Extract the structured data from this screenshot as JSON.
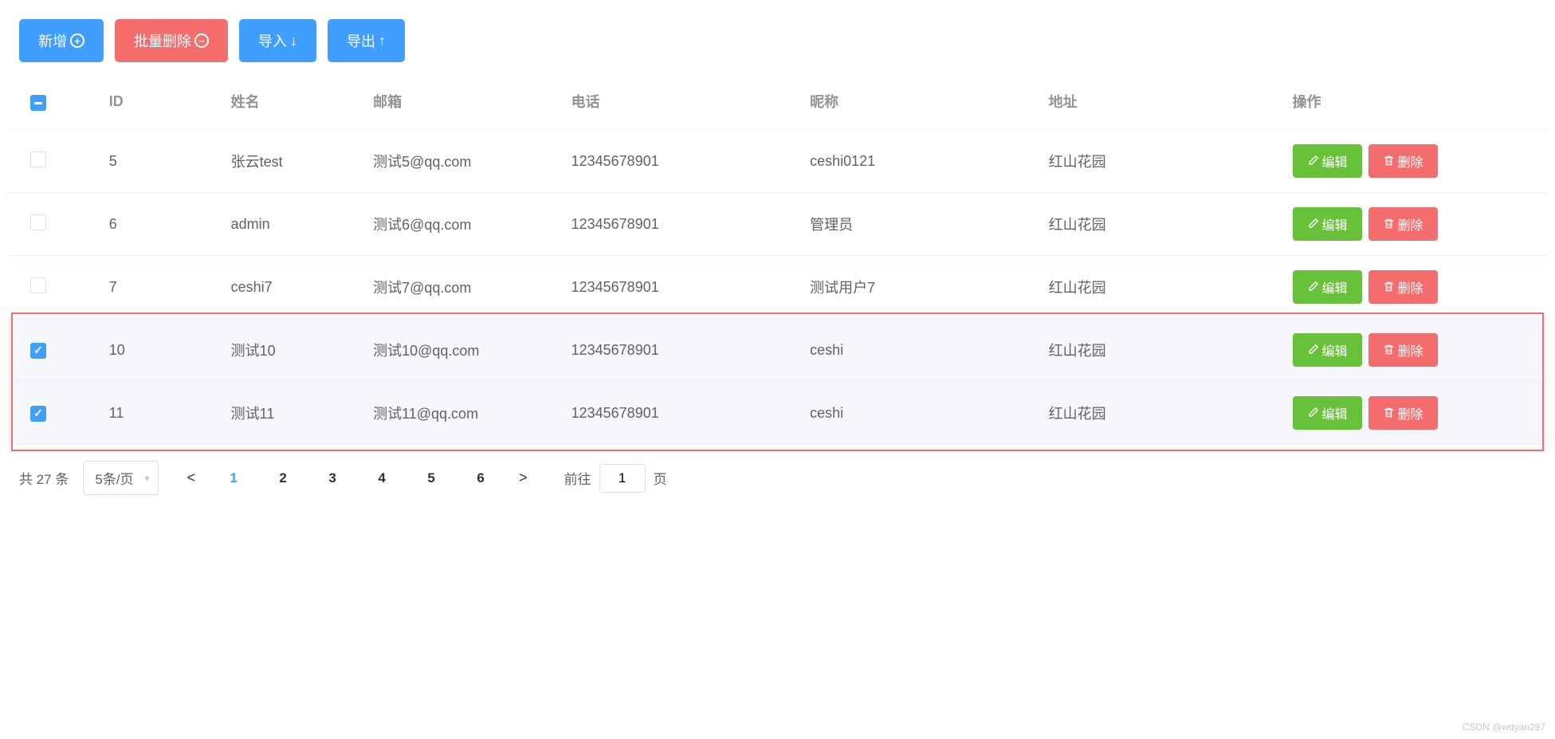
{
  "toolbar": {
    "add": "新增",
    "batch_delete": "批量删除",
    "import": "导入",
    "export": "导出"
  },
  "columns": {
    "id": "ID",
    "name": "姓名",
    "email": "邮箱",
    "phone": "电话",
    "nick": "昵称",
    "addr": "地址",
    "ops": "操作"
  },
  "row_buttons": {
    "edit": "编辑",
    "delete": "删除"
  },
  "rows": [
    {
      "checked": false,
      "id": "5",
      "name": "张云test",
      "email": "测试5@qq.com",
      "phone": "12345678901",
      "nick": "ceshi0121",
      "addr": "红山花园"
    },
    {
      "checked": false,
      "id": "6",
      "name": "admin",
      "email": "测试6@qq.com",
      "phone": "12345678901",
      "nick": "管理员",
      "addr": "红山花园"
    },
    {
      "checked": false,
      "id": "7",
      "name": "ceshi7",
      "email": "测试7@qq.com",
      "phone": "12345678901",
      "nick": "测试用户7",
      "addr": "红山花园"
    },
    {
      "checked": true,
      "id": "10",
      "name": "测试10",
      "email": "测试10@qq.com",
      "phone": "12345678901",
      "nick": "ceshi",
      "addr": "红山花园"
    },
    {
      "checked": true,
      "id": "11",
      "name": "测试11",
      "email": "测试11@qq.com",
      "phone": "12345678901",
      "nick": "ceshi",
      "addr": "红山花园"
    }
  ],
  "pagination": {
    "total_label": "共 27 条",
    "page_size_label": "5条/页",
    "pages": [
      "1",
      "2",
      "3",
      "4",
      "5",
      "6"
    ],
    "active_page": "1",
    "goto_prefix": "前往",
    "goto_value": "1",
    "goto_suffix": "页"
  },
  "watermark": "CSDN @wdyan297"
}
